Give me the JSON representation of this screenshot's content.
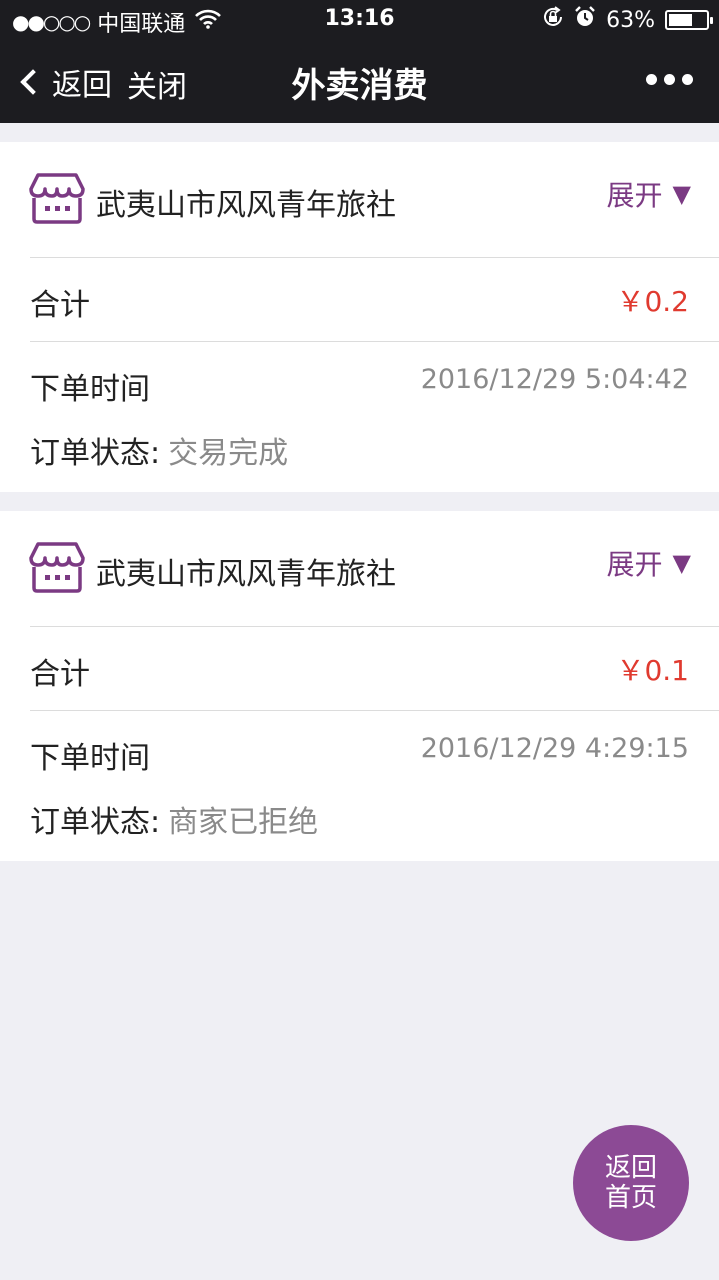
{
  "status_bar": {
    "signal": "●●○○○",
    "carrier": "中国联通",
    "time": "13:16",
    "battery": "63%",
    "battery_level": 0.63
  },
  "nav": {
    "back_label": "返回",
    "close_label": "关闭",
    "title": "外卖消费"
  },
  "orders": [
    {
      "shop_name": "武夷山市风风青年旅社",
      "expand_label": "展开",
      "total_label": "合计",
      "total": "￥0.2",
      "time_label": "下单时间",
      "time": "2016/12/29 5:04:42",
      "state_label": "订单状态:",
      "state": "交易完成"
    },
    {
      "shop_name": "武夷山市风风青年旅社",
      "expand_label": "展开",
      "total_label": "合计",
      "total": "￥0.1",
      "time_label": "下单时间",
      "time": "2016/12/29 4:29:15",
      "state_label": "订单状态:",
      "state": "商家已拒绝"
    }
  ],
  "home_button": {
    "line1": "返回",
    "line2": "首页"
  },
  "colors": {
    "accent": "#7b3a83",
    "price": "#e03a2f",
    "button": "#8c4a95",
    "topbar": "#1c1c20"
  }
}
